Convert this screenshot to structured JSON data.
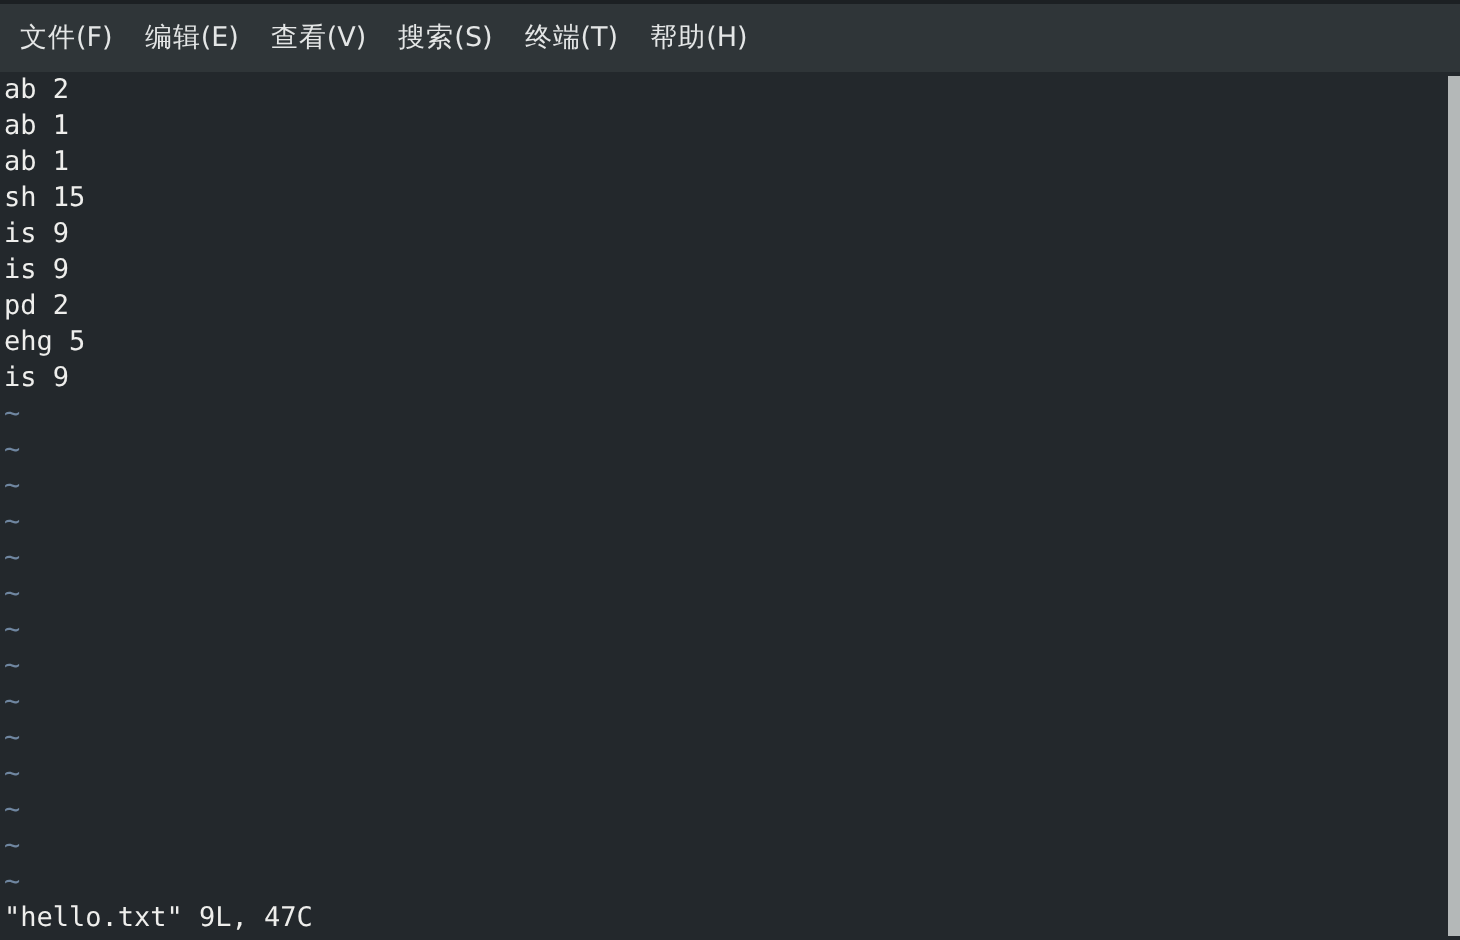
{
  "menu_bar": {
    "items": [
      "文件(F)",
      "编辑(E)",
      "查看(V)",
      "搜索(S)",
      "终端(T)",
      "帮助(H)"
    ]
  },
  "editor": {
    "lines": [
      "ab 2",
      "ab 1",
      "ab 1",
      "sh 15",
      "is 9",
      "is 9",
      "pd 2",
      "ehg 5",
      "is 9"
    ],
    "empty_line_markers": [
      "~",
      "~",
      "~",
      "~",
      "~",
      "~",
      "~",
      "~",
      "~",
      "~",
      "~",
      "~",
      "~",
      "~"
    ]
  },
  "status_line": "\"hello.txt\" 9L, 47C"
}
